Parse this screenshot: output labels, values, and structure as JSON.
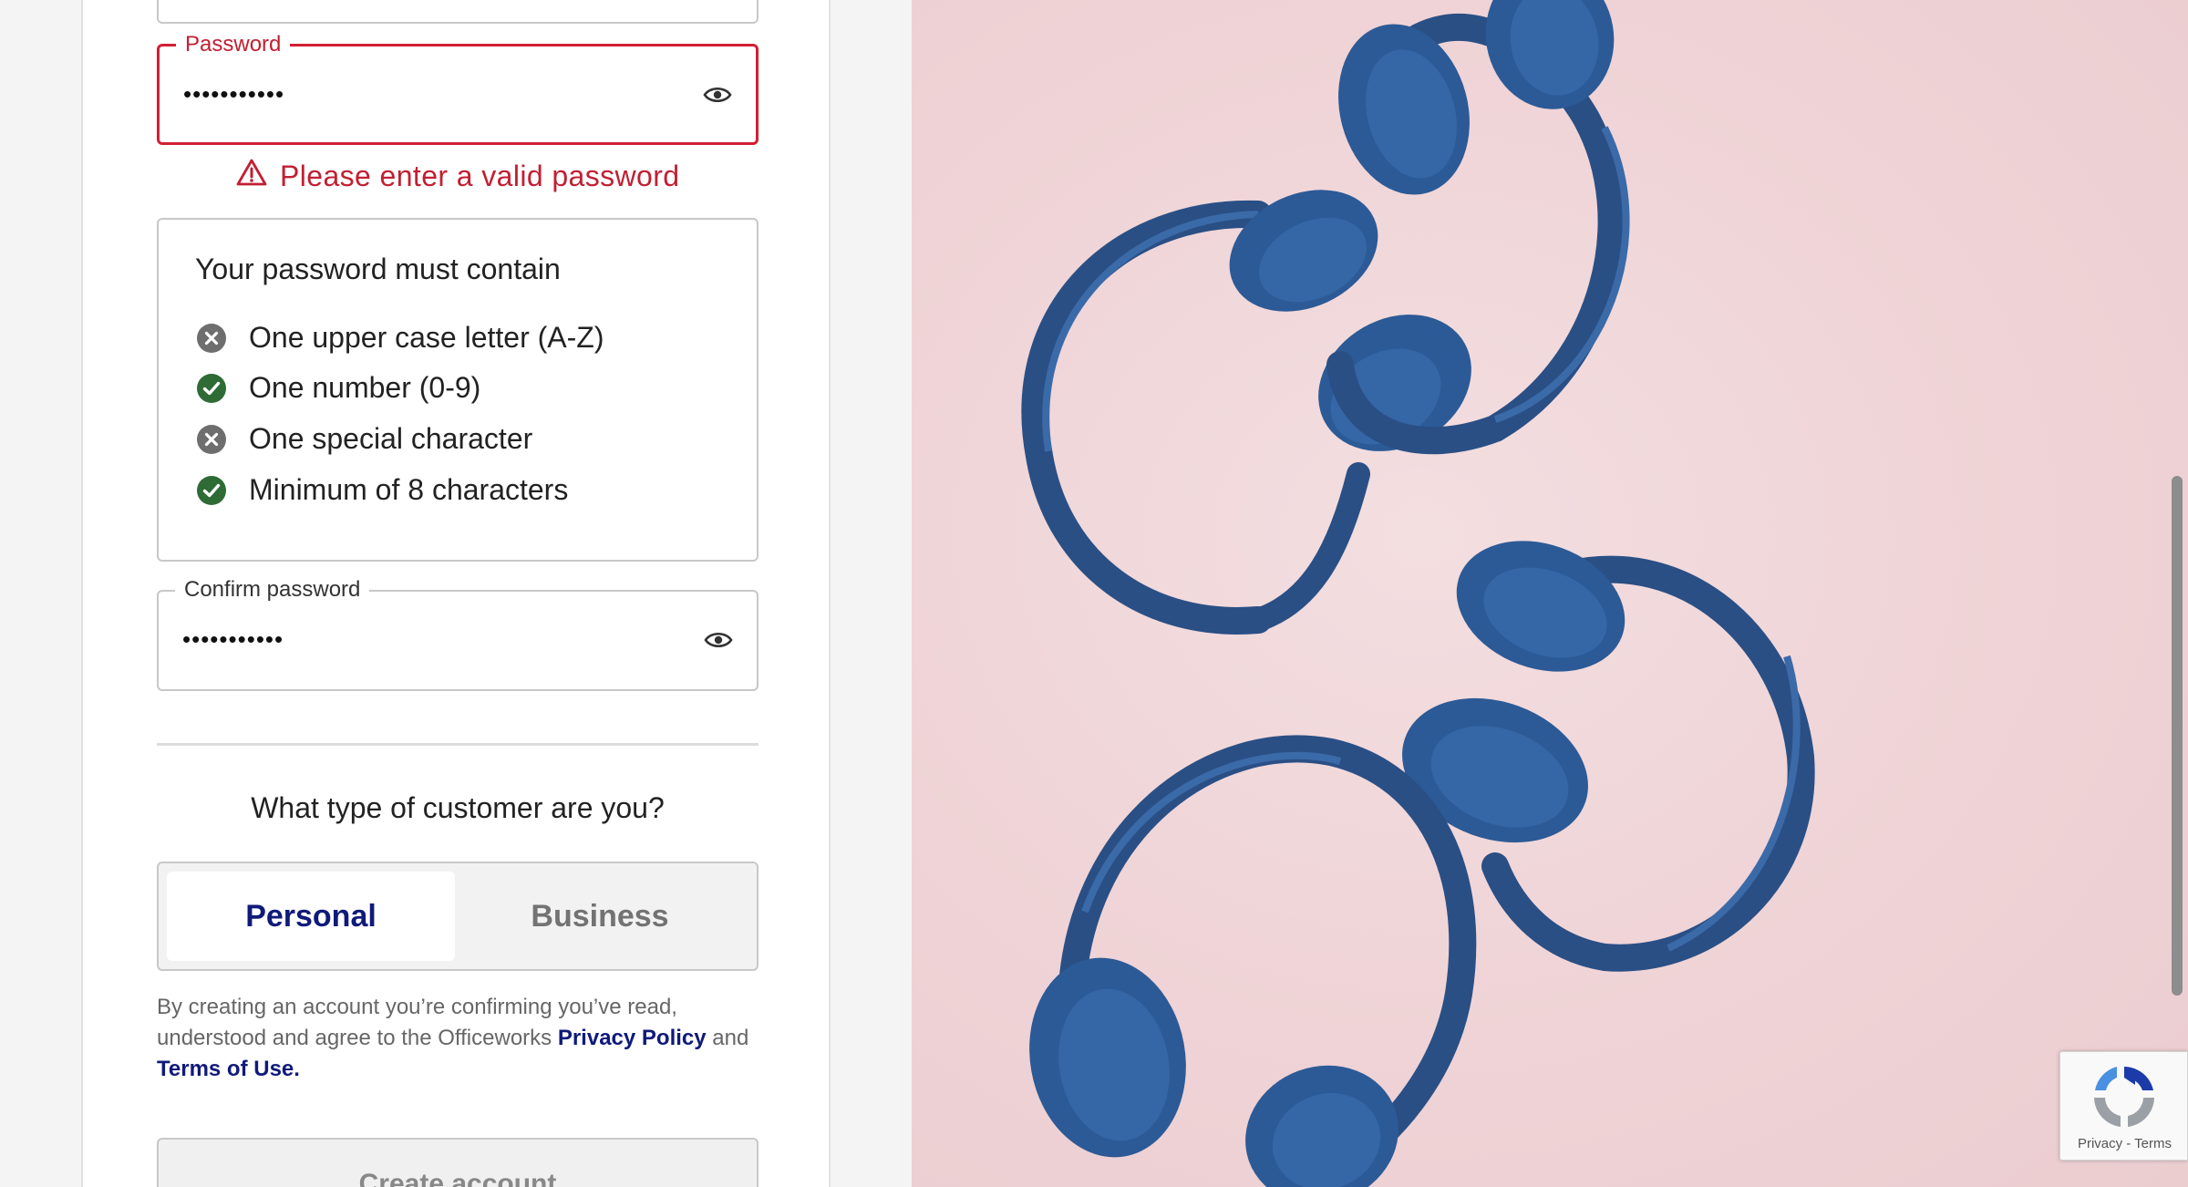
{
  "password_field": {
    "label": "Password",
    "value": "•••••••••••",
    "visibility_icon": "eye-icon",
    "error_message": "Please enter a valid password",
    "error_icon": "warning-triangle-icon"
  },
  "password_rules": {
    "title": "Your password must contain",
    "items": [
      {
        "label": "One upper case letter (A-Z)",
        "met": false,
        "icon": "x-circle-icon"
      },
      {
        "label": "One number (0-9)",
        "met": true,
        "icon": "check-circle-icon"
      },
      {
        "label": "One special character",
        "met": false,
        "icon": "x-circle-icon"
      },
      {
        "label": "Minimum of 8 characters",
        "met": true,
        "icon": "check-circle-icon"
      }
    ]
  },
  "confirm_field": {
    "label": "Confirm password",
    "value": "•••••••••••",
    "visibility_icon": "eye-icon"
  },
  "customer_type": {
    "question": "What type of customer are you?",
    "options": [
      "Personal",
      "Business"
    ],
    "selected": "Personal"
  },
  "legal": {
    "text_before": "By creating an account you’re confirming you’ve read, understood and agree to the Officeworks ",
    "privacy_link": "Privacy Policy",
    "text_middle": " and ",
    "terms_link": "Terms of Use."
  },
  "create_button": {
    "label": "Create account"
  },
  "recaptcha": {
    "label": "Privacy - Terms"
  },
  "colors": {
    "error": "#d21f35",
    "brand_navy": "#0f1a7a",
    "rule_met": "#2e6b35",
    "rule_unmet": "#6e6e6e",
    "photo_background": "#efd3d6",
    "headphones": "#2c5a96"
  }
}
